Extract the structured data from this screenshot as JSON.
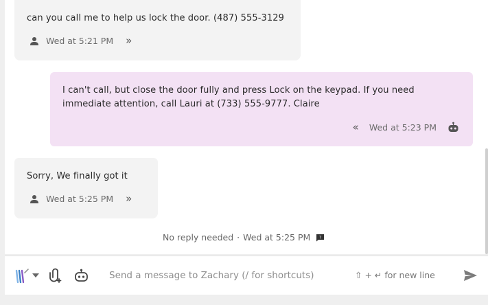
{
  "messages": [
    {
      "direction": "inbound",
      "text": "can you call me to help us lock the door. (487) 555-3129",
      "timestamp": "Wed at 5:21 PM"
    },
    {
      "direction": "outbound",
      "text": "I can't call, but close the door fully and press Lock on the keypad. If you need immediate attention, call Lauri at (733) 555-9777. Claire",
      "timestamp": "Wed at 5:23 PM"
    },
    {
      "direction": "inbound",
      "text": "Sorry, We finally got it",
      "timestamp": "Wed at 5:25 PM"
    }
  ],
  "status_line": {
    "label": "No reply needed",
    "separator": "·",
    "timestamp": "Wed at 5:25 PM"
  },
  "composer": {
    "placeholder": "Send a message to Zachary (/ for shortcuts)",
    "hint": "⇧ + ↵ for new line",
    "value": ""
  },
  "icons": {
    "inbound_sender": "person-icon",
    "outbound_sender": "robot-icon",
    "expand": "chevron-double-right-icon",
    "collapse": "chevron-double-left-icon",
    "status": "note-icon",
    "channel": "channel-logo-icon",
    "attach": "attach-icon",
    "ai": "robot-icon",
    "send": "send-icon"
  },
  "colors": {
    "inbound_bubble": "#f3f3f3",
    "outbound_bubble": "#f3e1f4",
    "background": "#efefef"
  }
}
